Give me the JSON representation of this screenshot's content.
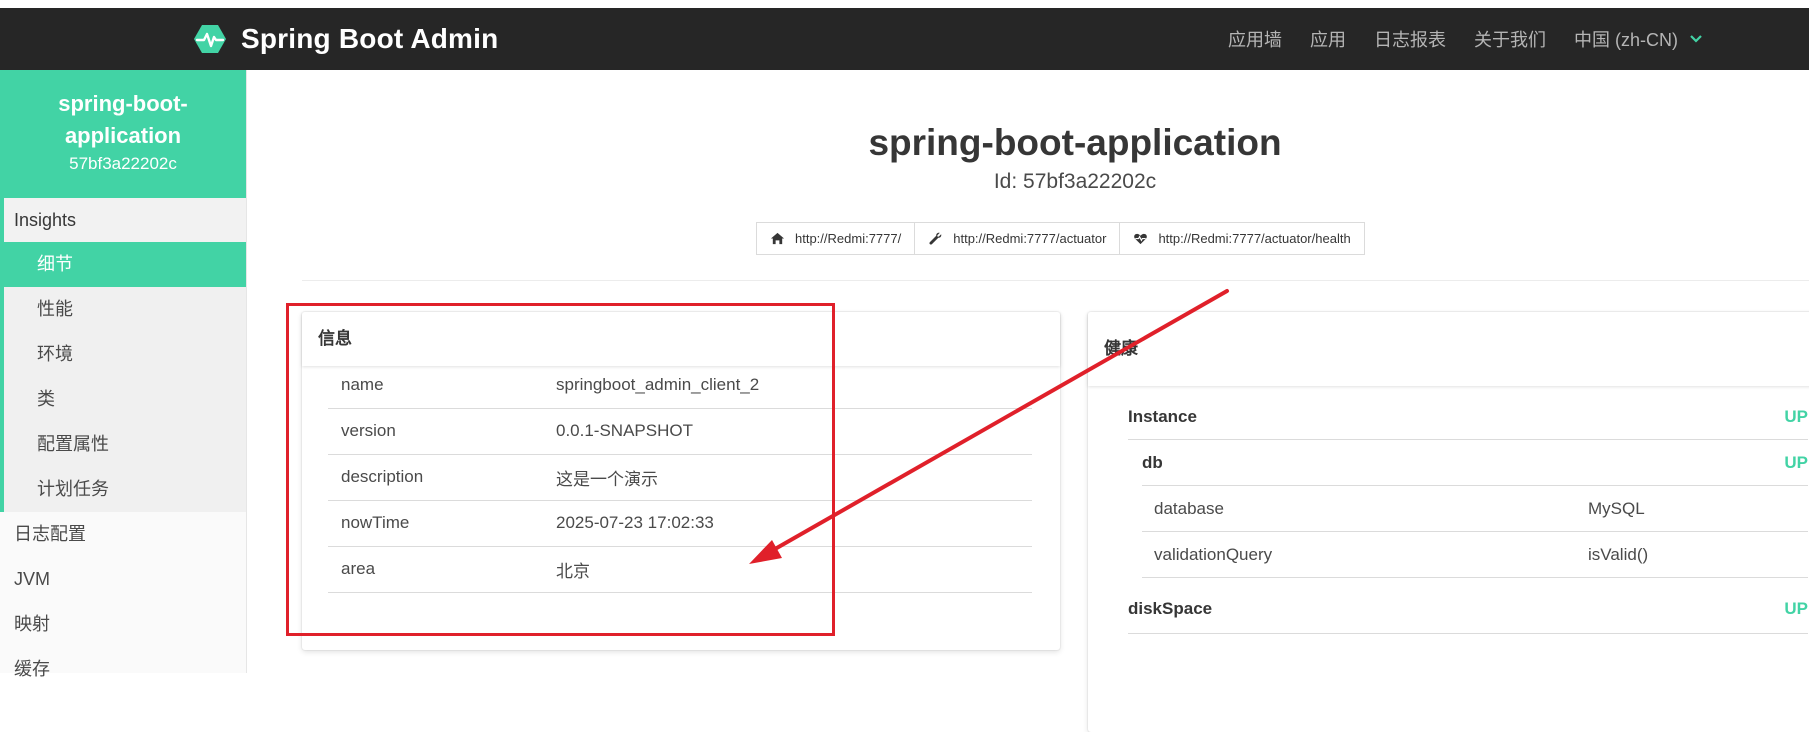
{
  "header": {
    "title": "Spring Boot Admin",
    "nav": [
      {
        "label": "应用墙"
      },
      {
        "label": "应用"
      },
      {
        "label": "日志报表"
      },
      {
        "label": "关于我们"
      },
      {
        "label": "中国 (zh-CN)"
      }
    ]
  },
  "sidebar": {
    "app_name_line1": "spring-boot-",
    "app_name_line2": "application",
    "app_id": "57bf3a22202c",
    "group_title": "Insights",
    "items": [
      {
        "label": "细节",
        "active": true
      },
      {
        "label": "性能"
      },
      {
        "label": "环境"
      },
      {
        "label": "类"
      },
      {
        "label": "配置属性"
      },
      {
        "label": "计划任务"
      }
    ],
    "top_items": [
      {
        "label": "日志配置"
      },
      {
        "label": "JVM"
      },
      {
        "label": "映射"
      },
      {
        "label": "缓存"
      }
    ]
  },
  "main": {
    "title": "spring-boot-application",
    "subtitle": "Id: 57bf3a22202c",
    "links": [
      {
        "label": "http://Redmi:7777/",
        "icon": "home-icon"
      },
      {
        "label": "http://Redmi:7777/actuator",
        "icon": "wrench-icon"
      },
      {
        "label": "http://Redmi:7777/actuator/health",
        "icon": "heartbeat-icon"
      }
    ]
  },
  "info_card": {
    "title": "信息",
    "rows": [
      {
        "key": "name",
        "value": "springboot_admin_client_2"
      },
      {
        "key": "version",
        "value": "0.0.1-SNAPSHOT"
      },
      {
        "key": "description",
        "value": "这是一个演示"
      },
      {
        "key": "nowTime",
        "value": "2025-07-23 17:02:33"
      },
      {
        "key": "area",
        "value": "北京"
      }
    ]
  },
  "health_card": {
    "title": "健康",
    "instance": {
      "label": "Instance",
      "status": "UP"
    },
    "db": {
      "label": "db",
      "status": "UP"
    },
    "db_details": [
      {
        "key": "database",
        "value": "MySQL"
      },
      {
        "key": "validationQuery",
        "value": "isValid()"
      }
    ],
    "diskspace": {
      "label": "diskSpace",
      "status": "UP"
    }
  },
  "colors": {
    "accent": "#42d3a5",
    "topbar": "#262626",
    "annotation": "#e0202a"
  }
}
